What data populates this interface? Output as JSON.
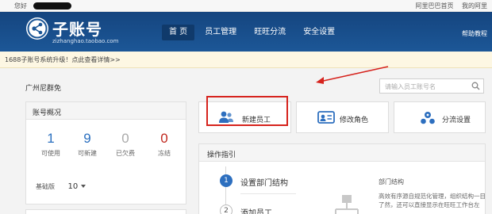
{
  "topbar": {
    "greeting": "您好",
    "links": [
      "阿里巴巴首页",
      "我的阿里"
    ]
  },
  "header": {
    "logo_title": "子账号",
    "logo_sub": "zizhanghao.taobao.com",
    "nav": [
      "首 页",
      "员工管理",
      "旺旺分流",
      "安全设置"
    ],
    "active_nav": 0,
    "help": "帮助教程",
    "accent": "#1c5797"
  },
  "notice": {
    "text": "1688子账号系统升级！点此查看详情>>"
  },
  "company": {
    "name": "广州尼群免"
  },
  "search": {
    "placeholder": "请输入员工账号名"
  },
  "overview": {
    "title": "账号概况",
    "stats": [
      {
        "value": "1",
        "label": "可使用",
        "color": "#2a6fbf"
      },
      {
        "value": "9",
        "label": "可新建",
        "color": "#2a6fbf"
      },
      {
        "value": "0",
        "label": "已欠费",
        "color": "#aaaaaa"
      },
      {
        "value": "0",
        "label": "冻结",
        "color": "#c0281e"
      }
    ],
    "version_label": "基础版",
    "version_value": "10"
  },
  "actions": [
    {
      "label": "新建员工",
      "icon": "add-user-icon"
    },
    {
      "label": "修改角色",
      "icon": "id-card-icon"
    },
    {
      "label": "分流设置",
      "icon": "distribution-icon"
    }
  ],
  "guide": {
    "title": "操作指引",
    "steps": [
      {
        "num": "1",
        "label": "设置部门结构"
      },
      {
        "num": "2",
        "label": "添加员工"
      }
    ],
    "dept_title": "部门结构",
    "dept_desc": "高效有序源自规范化管理，组织结构一目了然，还可以直接显示在旺旺工作台左"
  }
}
